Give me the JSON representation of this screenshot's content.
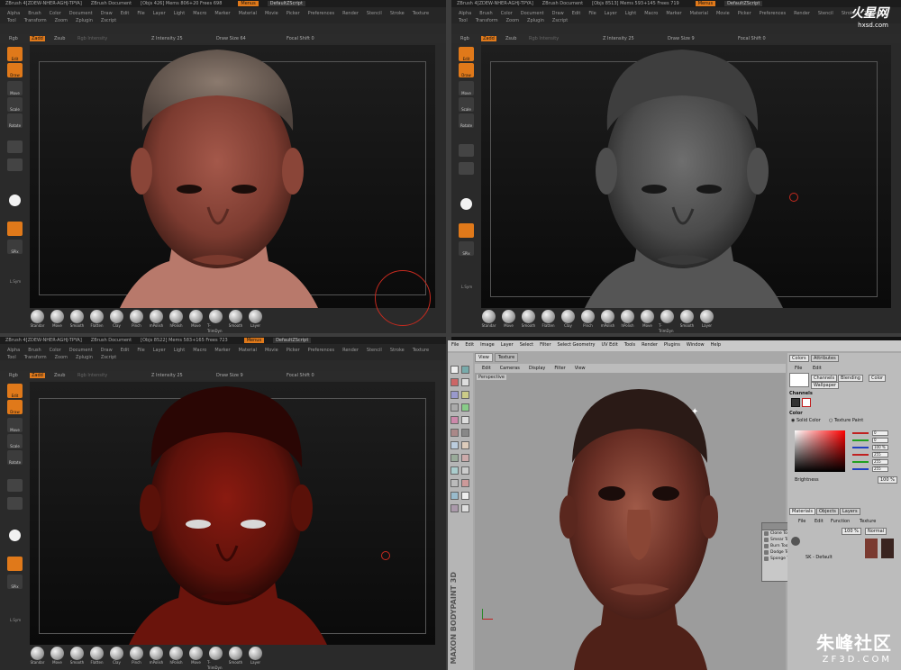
{
  "zbrush": {
    "title_app": "ZBrush 4[ZDEW-NHER-AGHJ-TPYA]",
    "title_doc": "ZBrush Document",
    "menus_btn": "Menus",
    "script_btn": "DefaultZScript",
    "menu_items": [
      "Alpha",
      "Brush",
      "Color",
      "Document",
      "Draw",
      "Edit",
      "File",
      "Layer",
      "Light",
      "Macro",
      "Marker",
      "Material",
      "Movie",
      "Picker",
      "Preferences",
      "Render",
      "Stencil",
      "Stroke",
      "Texture",
      "Tool",
      "Transform",
      "Zoom",
      "Zplugin",
      "Zscript"
    ],
    "rgb": "Rgb",
    "zadd": "Zadd",
    "zsub": "Zsub",
    "rgb_intensity": "Rgb Intensity",
    "z_intensity": "Z Intensity 25",
    "draw_size": "Draw Size 64",
    "draw_size_small": "Draw Size 9",
    "focal_shift": "Focal Shift 0",
    "side_labels": [
      "Edit",
      "Draw",
      "Move",
      "Scale",
      "Rotate",
      "Alpha",
      "Stroke",
      "Texture",
      "Mat Cap",
      "SPix",
      "L.Sym"
    ],
    "brushes": [
      "Standar",
      "Move",
      "Smooth",
      "Flatten",
      "Clay",
      "Pinch",
      "mPolish",
      "hPolish",
      "Move",
      "T-TrimDyn",
      "Smooth",
      "Layer"
    ],
    "stats": [
      "[Objs 426] Mems 806+20 Frees 698",
      "[Objs 8513] Mems 593+145 Frees 719",
      "[Objs 8522] Mems 583+165 Frees 723"
    ]
  },
  "bodypaint": {
    "menu": [
      "File",
      "Edit",
      "Image",
      "Layer",
      "Select",
      "Filter",
      "Select Geometry",
      "UV Edit",
      "Tools",
      "Render",
      "Plugins",
      "Window",
      "Help"
    ],
    "tabs": [
      "View",
      "Texture"
    ],
    "view_menu": [
      "Edit",
      "Cameras",
      "Display",
      "Filter",
      "View"
    ],
    "perspective": "Perspective",
    "right_tabs": [
      "Colors",
      "Attributes"
    ],
    "right_menu": [
      "File",
      "Edit"
    ],
    "channel_tabs": [
      "Channels",
      "Blending",
      "Color",
      "Wallpaper"
    ],
    "channels_title": "Channels",
    "color_title": "Color",
    "solid_color": "Solid Color",
    "texture_paint": "Texture Paint",
    "rgb_values": [
      "0",
      "0",
      "100 %",
      "255",
      "255",
      "255"
    ],
    "brightness": "Brightness",
    "brightness_val": "100 %",
    "mat_tabs": [
      "Materials",
      "Objects",
      "Layers"
    ],
    "mat_menu": [
      "File",
      "Edit",
      "Function",
      "Texture"
    ],
    "mat_percent": "100 %",
    "mat_mode": "Normal",
    "mat_item": "SK - Default",
    "floater_tools": [
      "Clone Tool",
      "Smear Tool",
      "Burn Tool",
      "Dodge Tool",
      "Sponge Tool"
    ],
    "maxon": "MAXON BODYPAINT 3D"
  },
  "watermarks": {
    "top_cn": "火星网",
    "top_en": "hxsd.com",
    "bottom_cn": "朱峰社区",
    "bottom_en": "ZF3D.COM"
  }
}
